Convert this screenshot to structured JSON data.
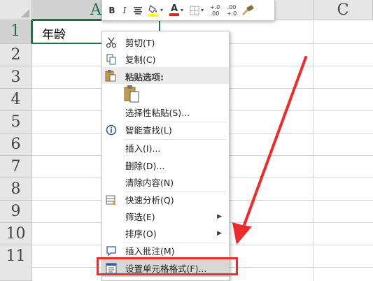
{
  "sheet": {
    "columns": [
      {
        "label": "A",
        "selected": true
      },
      {
        "label": "",
        "selected": false
      },
      {
        "label": "C",
        "selected": false
      }
    ],
    "rows": [
      "1",
      "2",
      "3",
      "4",
      "5",
      "6",
      "7",
      "8",
      "9",
      "10",
      "11"
    ],
    "selected_row": "1",
    "cells": {
      "A1": "年龄"
    },
    "accent_color": "#217346"
  },
  "mini_toolbar": {
    "bold": "B",
    "italic": "I",
    "align_icon": "align-center-icon",
    "fill_icon": "fill-color-icon",
    "font_color_letter": "A",
    "border_icon": "borders-icon",
    "dropdown_arrow": "▾",
    "increase_decimal": "+.0 .00",
    "decrease_decimal": ".00 +.0",
    "format_painter_icon": "format-painter-icon"
  },
  "context_menu": {
    "cut": "剪切(T)",
    "copy": "复制(C)",
    "paste_options_header": "粘贴选项:",
    "paste_special": "选择性粘贴(S)...",
    "smart_lookup": "智能查找(L)",
    "insert": "插入(I)...",
    "delete": "删除(D)...",
    "clear_contents": "清除内容(N)",
    "quick_analysis": "快速分析(Q)",
    "filter": "筛选(E)",
    "sort": "排序(O)",
    "insert_comment": "插入批注(M)",
    "format_cells": "设置单元格格式(F)...",
    "submenu_arrow": "▶"
  },
  "annotation": {
    "color": "#ee2a2a"
  }
}
